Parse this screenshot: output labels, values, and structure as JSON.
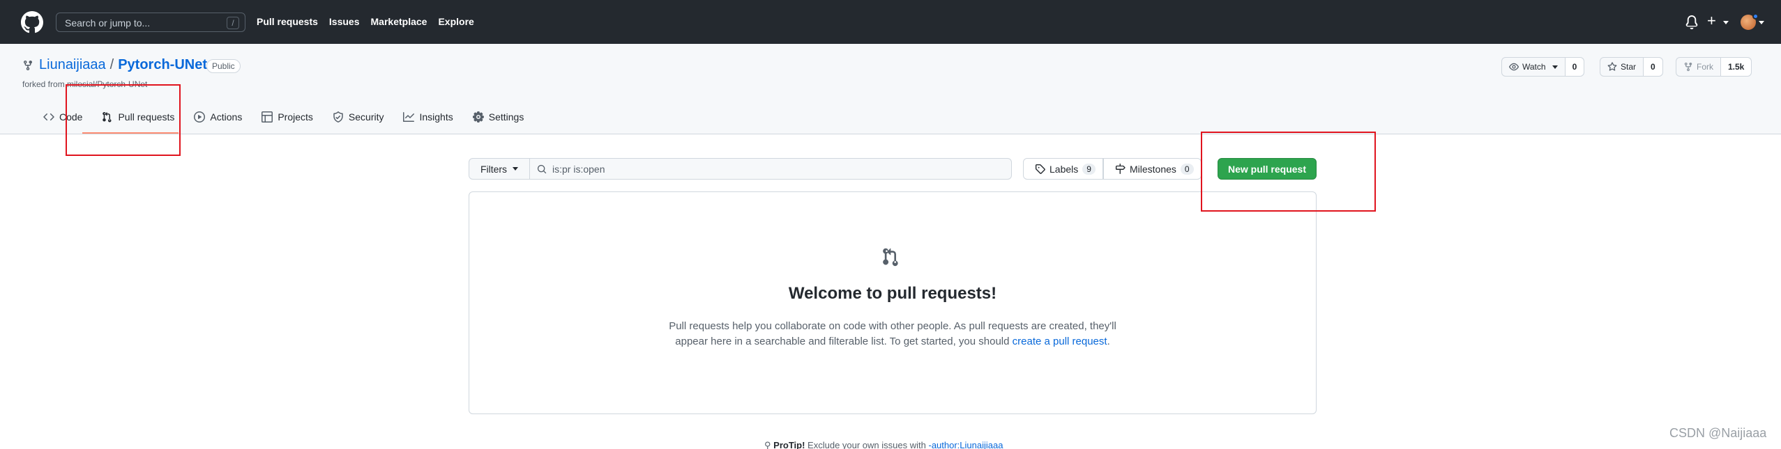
{
  "header": {
    "search_placeholder": "Search or jump to...",
    "search_shortcut": "/",
    "nav": [
      "Pull requests",
      "Issues",
      "Marketplace",
      "Explore"
    ],
    "plus": "+"
  },
  "repo": {
    "owner": "Liunaijiaaa",
    "separator": "/",
    "name": "Pytorch-UNet",
    "visibility": "Public",
    "forked_text": "forked from milesial/Pytorch-UNet",
    "watch_label": "Watch",
    "watch_count": "0",
    "star_label": "Star",
    "star_count": "0",
    "fork_label": "Fork",
    "fork_count": "1.5k"
  },
  "tabs": [
    "Code",
    "Pull requests",
    "Actions",
    "Projects",
    "Security",
    "Insights",
    "Settings"
  ],
  "filters": {
    "filters_label": "Filters",
    "query": "is:pr is:open",
    "labels_label": "Labels",
    "labels_count": "9",
    "milestones_label": "Milestones",
    "milestones_count": "0",
    "new_pr_label": "New pull request"
  },
  "blankslate": {
    "title": "Welcome to pull requests!",
    "line1": "Pull requests help you collaborate on code with other people. As pull requests are created, they'll",
    "line2": "appear here in a searchable and filterable list. To get started, you should",
    "link": "create a pull request",
    "end": "."
  },
  "protip": {
    "label": "ProTip!",
    "text": "Exclude your own issues with",
    "link": "-author:Liunaijiaaa"
  },
  "watermark": "CSDN @Naijiaaa",
  "colors": {
    "header_bg": "#24292f",
    "link": "#0969da",
    "primary_button": "#2da44e",
    "active_tab_underline": "#fd8c73",
    "annotation_red": "#e0141e"
  }
}
